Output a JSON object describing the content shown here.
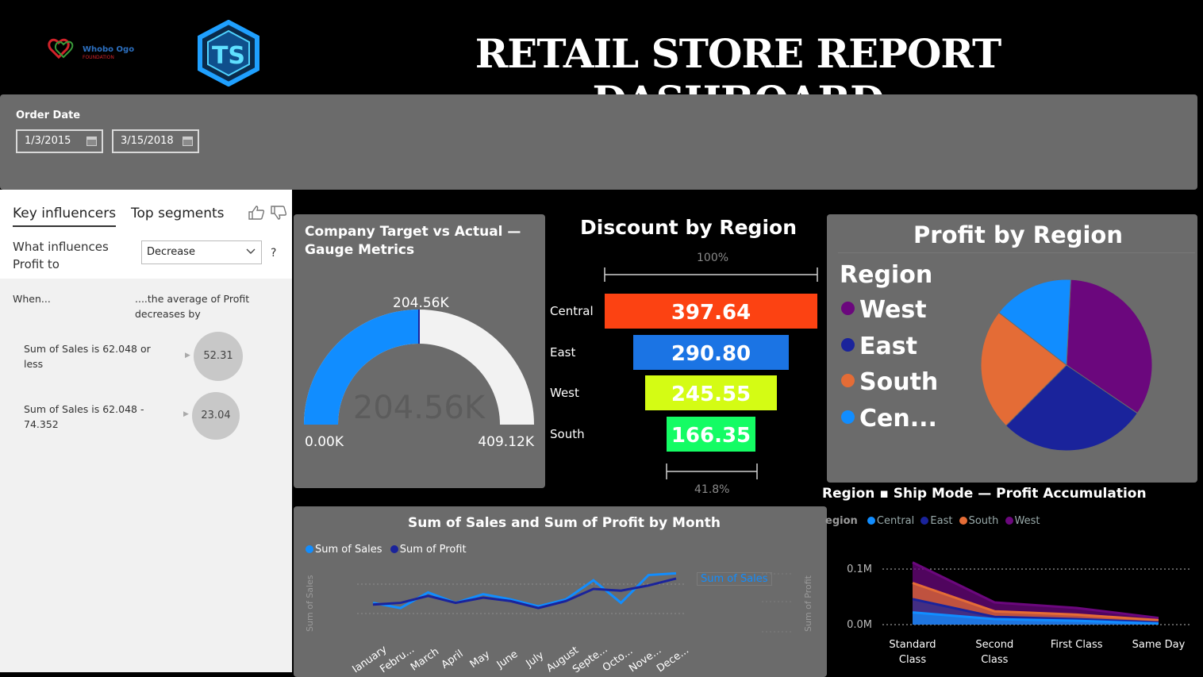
{
  "header": {
    "title": "RETAIL STORE REPORT DASHBOARD",
    "logo_left_text": "Whobo Ogo",
    "logo_left_sub": "FOUNDATION",
    "logo_right_text": "TS"
  },
  "filter": {
    "label": "Order Date",
    "start_date": "1/3/2015",
    "end_date": "3/15/2018"
  },
  "key_influencers": {
    "tabs": [
      "Key influencers",
      "Top segments"
    ],
    "question": "What influences Profit to",
    "selected": "Decrease",
    "help": "?",
    "when_label": "When...",
    "avg_label": "....the average of Profit decreases by",
    "rows": [
      {
        "condition": "Sum of Sales is 62.048 or less",
        "value": "52.31"
      },
      {
        "condition": "Sum of Sales is 62.048 - 74.352",
        "value": "23.04"
      }
    ]
  },
  "gauge": {
    "title": "Company Target vs Actual — Gauge Metrics",
    "value_label": "204.56K",
    "center_label": "204.56K",
    "min_label": "0.00K",
    "max_label": "409.12K",
    "value": 204.56,
    "min": 0,
    "max": 409.12,
    "fill_color": "#118dff",
    "track_color": "#f2f2f2"
  },
  "discount": {
    "title": "Discount by Region",
    "top_pct": "100%",
    "bottom_pct": "41.8%",
    "bars": [
      {
        "category": "Central",
        "label": "397.64",
        "value": 397.64,
        "color": "#fc4212"
      },
      {
        "category": "East",
        "label": "290.80",
        "value": 290.8,
        "color": "#1b74e4"
      },
      {
        "category": "West",
        "label": "245.55",
        "value": 245.55,
        "color": "#d4fc14"
      },
      {
        "category": "South",
        "label": "166.35",
        "value": 166.35,
        "color": "#14fc64"
      }
    ]
  },
  "profit_region": {
    "title": "Profit by Region",
    "legend_title": "Region",
    "legend": [
      {
        "label": "West",
        "color": "#6b077d"
      },
      {
        "label": "East",
        "color": "#1a239b"
      },
      {
        "label": "South",
        "color": "#e46c36"
      },
      {
        "label": "Cen...",
        "color": "#118dff"
      }
    ]
  },
  "ship_mode": {
    "title": "Region ▪ Ship Mode — Profit Accumulation",
    "legend_label": "egion",
    "legend": [
      {
        "label": "Central",
        "color": "#118dff"
      },
      {
        "label": "East",
        "color": "#1a239b"
      },
      {
        "label": "South",
        "color": "#e46c36"
      },
      {
        "label": "West",
        "color": "#6b077d"
      }
    ],
    "y_ticks": [
      "0.1M",
      "0.0M"
    ],
    "categories": [
      "Standard Class",
      "Second Class",
      "First Class",
      "Same Day"
    ]
  },
  "sales_profit": {
    "title": "Sum of Sales and Sum of Profit by Month",
    "legend": [
      {
        "label": "Sum of Sales",
        "color": "#118dff"
      },
      {
        "label": "Sum of Profit",
        "color": "#1a239b"
      }
    ],
    "y_left_label": "Sum of Sales",
    "y_right_label": "Sum of Profit",
    "tooltip": "Sum of Sales",
    "months": [
      "January",
      "Febru...",
      "March",
      "April",
      "May",
      "June",
      "July",
      "August",
      "Septe...",
      "Octo...",
      "Nove...",
      "Dece..."
    ]
  },
  "chart_data": [
    {
      "type": "gauge",
      "title": "Company Target vs Actual — Gauge Metrics",
      "value": 204.56,
      "min": 0,
      "max": 409.12,
      "unit": "K"
    },
    {
      "type": "bar",
      "title": "Discount by Region",
      "categories": [
        "Central",
        "East",
        "West",
        "South"
      ],
      "values": [
        397.64,
        290.8,
        245.55,
        166.35
      ]
    },
    {
      "type": "pie",
      "title": "Profit by Region",
      "categories": [
        "West",
        "East",
        "South",
        "Cen..."
      ],
      "values": [
        0.337,
        0.28,
        0.23,
        0.153
      ]
    },
    {
      "type": "area",
      "title": "Region ▪ Ship Mode — Profit Accumulation",
      "categories": [
        "Standard Class",
        "Second Class",
        "First Class",
        "Same Day"
      ],
      "series": [
        {
          "name": "Central",
          "values": [
            0.022,
            0.01,
            0.007,
            0.002
          ]
        },
        {
          "name": "East",
          "values": [
            0.046,
            0.014,
            0.01,
            0.004
          ]
        },
        {
          "name": "South",
          "values": [
            0.075,
            0.024,
            0.018,
            0.008
          ]
        },
        {
          "name": "West",
          "values": [
            0.112,
            0.04,
            0.03,
            0.012
          ]
        }
      ],
      "y_ticks": [
        "0.1M",
        "0.0M"
      ]
    },
    {
      "type": "line",
      "title": "Sum of Sales and Sum of Profit by Month",
      "categories": [
        "January",
        "Febru...",
        "March",
        "April",
        "May",
        "June",
        "July",
        "August",
        "Septe...",
        "Octo...",
        "Nove...",
        "Dece..."
      ],
      "series": [
        {
          "name": "Sum of Sales",
          "values": [
            0.13,
            0.1,
            0.19,
            0.13,
            0.18,
            0.15,
            0.11,
            0.15,
            0.26,
            0.13,
            0.29,
            0.3
          ]
        },
        {
          "name": "Sum of Profit",
          "values": [
            0.12,
            0.13,
            0.17,
            0.13,
            0.16,
            0.14,
            0.1,
            0.14,
            0.21,
            0.2,
            0.23,
            0.27
          ]
        }
      ]
    }
  ]
}
